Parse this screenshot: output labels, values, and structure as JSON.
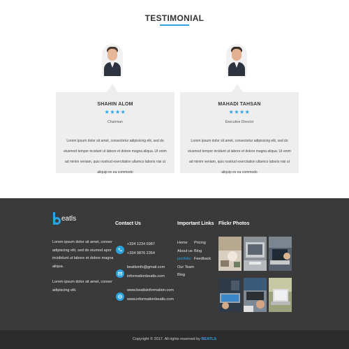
{
  "testimonial": {
    "title": "TESTIMONIAL",
    "items": [
      {
        "name": "SHAHIN ALOM",
        "stars": "★★★★",
        "role": "Chairman",
        "text": "Lorem ipsum dolor sit amet, consectetur adipisicing elit, sed do eiusmod tempor incidunt ut labore et dolore magna aliqua. Ut enim ad minim veniam, quis nostrud exercitation ullamco laboris nisi ut aliquip ex ea commodo"
      },
      {
        "name": "MAHADI TAHSAN",
        "stars": "★★★★",
        "role": "Executive Director",
        "text": "Lorem ipsum dolor sit amet, consectetur adipisicing elit, sed do eiusmod tempor incidunt ut labore et dolore magna aliqua. Ut enim ad minim veniam, quis nostrud exercitation ullamco laboris nisi ut aliquip ex ea commodo"
      }
    ]
  },
  "footer": {
    "logo_text": "eatls",
    "about": [
      "Lorem ipsum dolor sit amet, conser adipiscing elit, sed do eiumod apor incididunt ut labore et dolore magna aliqua.",
      "Lorem ipsum dolor sit amet, conser adipiscing elit."
    ],
    "contact_title": "Contact Us",
    "contact": {
      "phones": [
        "+334 1234 5987",
        "+334 9876 2354"
      ],
      "emails": [
        "beatlsinfo@gmail.com",
        "informationbeatls.com"
      ],
      "sites": [
        "www.beatlsinformation.com",
        "www.informationbeatls.com"
      ]
    },
    "links_title": "Important Links",
    "links_col1": [
      "Home",
      "About us",
      "portfolio",
      "Our Team",
      "Blog"
    ],
    "links_col2": [
      "Pricing",
      "Blog",
      "Feedback"
    ],
    "active_link": "portfolio",
    "flickr_title": "Flickr Photos"
  },
  "copyright": {
    "text": "Copyright © 2017. All rights reserved by",
    "brand": "BEATLS"
  },
  "colors": {
    "accent": "#2aa3e0",
    "footer_bg": "#3a3a3a",
    "bottom_bar_bg": "#2c2c2c",
    "card_bg": "#eeeeee"
  }
}
